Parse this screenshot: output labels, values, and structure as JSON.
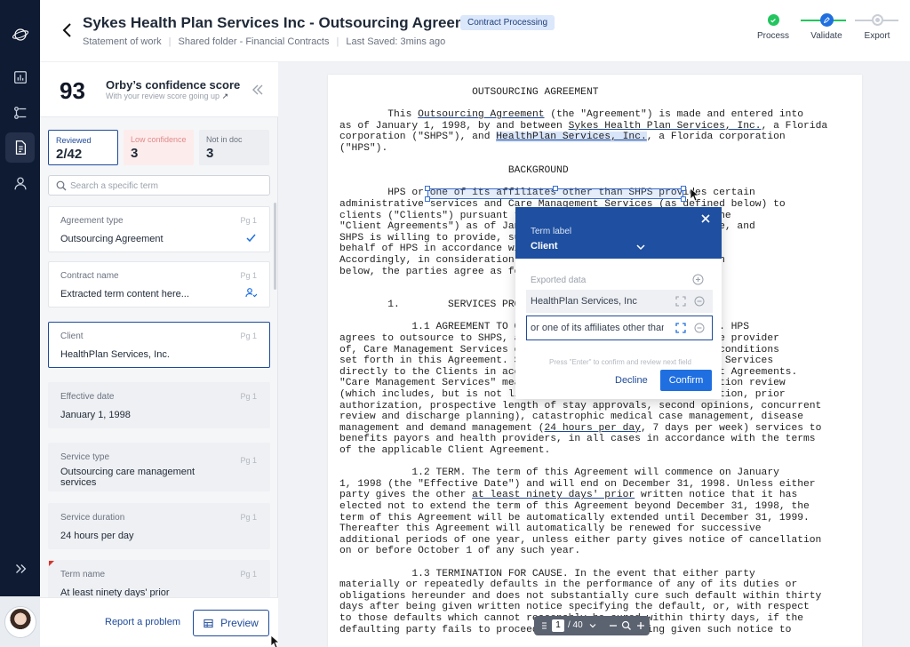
{
  "header": {
    "title": "Sykes Health Plan Services Inc - Outsourcing Agreement",
    "badge": "Contract Processing",
    "meta": [
      "Statement of work",
      "Shared folder - Financial Contracts",
      "Last Saved: 3mins ago"
    ]
  },
  "stepper": {
    "steps": [
      {
        "label": "Process",
        "state": "done"
      },
      {
        "label": "Validate",
        "state": "active"
      },
      {
        "label": "Export",
        "state": "pending"
      }
    ]
  },
  "score": {
    "value": "93",
    "title": "Orby’s confidence score",
    "subtitle": "With your review score going up"
  },
  "stats": [
    {
      "label": "Reviewed",
      "value": "2/42"
    },
    {
      "label": "Low confidence",
      "value": "3"
    },
    {
      "label": "Not in doc",
      "value": "3"
    }
  ],
  "search": {
    "placeholder": "Search a specific term"
  },
  "terms": [
    {
      "label": "Agreement type",
      "page": "Pg 1",
      "value": "Outsourcing Agreement",
      "status": "check-icon"
    },
    {
      "label": "Contract name",
      "page": "Pg 1",
      "value": "Extracted term content here...",
      "status": "assign-user-icon"
    },
    {
      "label": "Client",
      "page": "Pg 1",
      "value": "HealthPlan Services, Inc.",
      "status": ""
    },
    {
      "label": "Effective date",
      "page": "Pg 1",
      "value": "January 1, 1998",
      "status": ""
    },
    {
      "label": "Service type",
      "page": "Pg 1",
      "value": "Outsourcing care management services",
      "status": ""
    },
    {
      "label": "Service duration",
      "page": "Pg 1",
      "value": "24 hours per day",
      "status": ""
    },
    {
      "label": "Term name",
      "page": "Pg 1",
      "value": "At least ninety days' prior",
      "status": ""
    }
  ],
  "footer": {
    "report": "Report a problem",
    "preview": "Preview"
  },
  "popup": {
    "term_label": "Term label",
    "term_value": "Client",
    "exported_label": "Exported data",
    "row1": "HealthPlan Services, Inc",
    "row2": "or one of its affiliates other than SHPS",
    "hint": "Press \"Enter\" to confirm and review next field",
    "decline": "Decline",
    "confirm": "Confirm"
  },
  "pager": {
    "page": "1",
    "total": "/ 40"
  },
  "colors": {
    "rail": "#0f1b33",
    "accent": "#1e4a9a",
    "popup_header": "#1e4fa0",
    "confirm": "#1f6fe0",
    "success": "#22c55e"
  }
}
